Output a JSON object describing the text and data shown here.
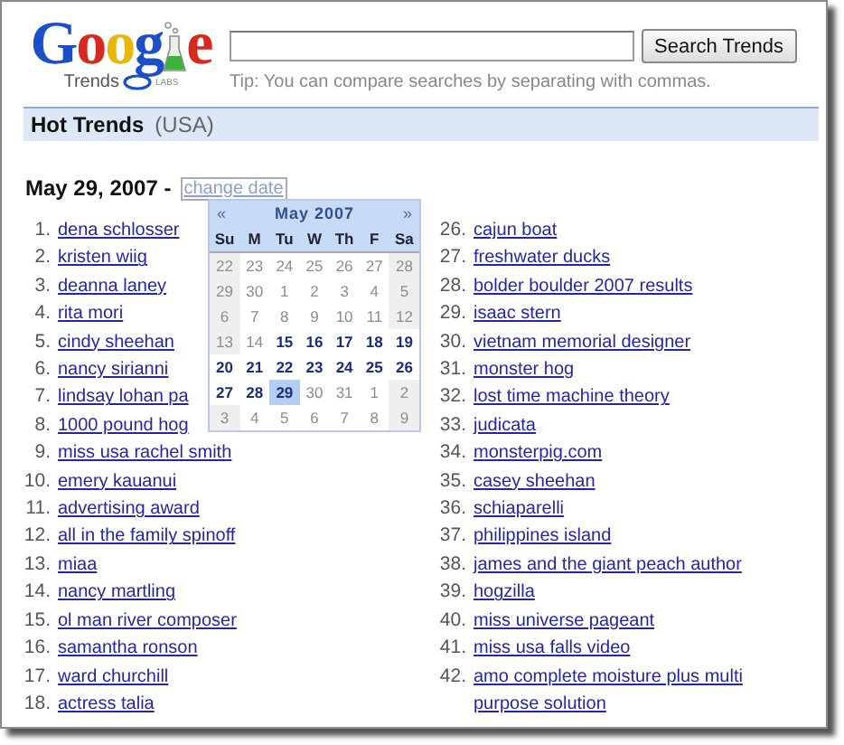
{
  "logo": {
    "text_start": "Goog",
    "text_end": "e",
    "subtitle": "Trends",
    "badge": "LABS"
  },
  "search": {
    "button": "Search Trends",
    "tip": "Tip: You can compare searches by separating with commas."
  },
  "section": {
    "title": "Hot Trends",
    "region": "(USA)"
  },
  "date": {
    "label": "May 29, 2007 -",
    "change_link": "change date"
  },
  "calendar": {
    "prev": "«",
    "month": "May 2007",
    "next": "»",
    "weekdays": [
      "Su",
      "M",
      "Tu",
      "W",
      "Th",
      "F",
      "Sa"
    ],
    "weeks": [
      [
        {
          "day": "22",
          "enabled": false,
          "selected": false
        },
        {
          "day": "23",
          "enabled": false,
          "selected": false
        },
        {
          "day": "24",
          "enabled": false,
          "selected": false
        },
        {
          "day": "25",
          "enabled": false,
          "selected": false
        },
        {
          "day": "26",
          "enabled": false,
          "selected": false
        },
        {
          "day": "27",
          "enabled": false,
          "selected": false
        },
        {
          "day": "28",
          "enabled": false,
          "selected": false
        }
      ],
      [
        {
          "day": "29",
          "enabled": false,
          "selected": false
        },
        {
          "day": "30",
          "enabled": false,
          "selected": false
        },
        {
          "day": "1",
          "enabled": false,
          "selected": false
        },
        {
          "day": "2",
          "enabled": false,
          "selected": false
        },
        {
          "day": "3",
          "enabled": false,
          "selected": false
        },
        {
          "day": "4",
          "enabled": false,
          "selected": false
        },
        {
          "day": "5",
          "enabled": false,
          "selected": false
        }
      ],
      [
        {
          "day": "6",
          "enabled": false,
          "selected": false
        },
        {
          "day": "7",
          "enabled": false,
          "selected": false
        },
        {
          "day": "8",
          "enabled": false,
          "selected": false
        },
        {
          "day": "9",
          "enabled": false,
          "selected": false
        },
        {
          "day": "10",
          "enabled": false,
          "selected": false
        },
        {
          "day": "11",
          "enabled": false,
          "selected": false
        },
        {
          "day": "12",
          "enabled": false,
          "selected": false
        }
      ],
      [
        {
          "day": "13",
          "enabled": false,
          "selected": false
        },
        {
          "day": "14",
          "enabled": false,
          "selected": false
        },
        {
          "day": "15",
          "enabled": true,
          "selected": false
        },
        {
          "day": "16",
          "enabled": true,
          "selected": false
        },
        {
          "day": "17",
          "enabled": true,
          "selected": false
        },
        {
          "day": "18",
          "enabled": true,
          "selected": false
        },
        {
          "day": "19",
          "enabled": true,
          "selected": false
        }
      ],
      [
        {
          "day": "20",
          "enabled": true,
          "selected": false
        },
        {
          "day": "21",
          "enabled": true,
          "selected": false
        },
        {
          "day": "22",
          "enabled": true,
          "selected": false
        },
        {
          "day": "23",
          "enabled": true,
          "selected": false
        },
        {
          "day": "24",
          "enabled": true,
          "selected": false
        },
        {
          "day": "25",
          "enabled": true,
          "selected": false
        },
        {
          "day": "26",
          "enabled": true,
          "selected": false
        }
      ],
      [
        {
          "day": "27",
          "enabled": true,
          "selected": false
        },
        {
          "day": "28",
          "enabled": true,
          "selected": false
        },
        {
          "day": "29",
          "enabled": true,
          "selected": true
        },
        {
          "day": "30",
          "enabled": false,
          "selected": false
        },
        {
          "day": "31",
          "enabled": false,
          "selected": false
        },
        {
          "day": "1",
          "enabled": false,
          "selected": false
        },
        {
          "day": "2",
          "enabled": false,
          "selected": false
        }
      ],
      [
        {
          "day": "3",
          "enabled": false,
          "selected": false
        },
        {
          "day": "4",
          "enabled": false,
          "selected": false
        },
        {
          "day": "5",
          "enabled": false,
          "selected": false
        },
        {
          "day": "6",
          "enabled": false,
          "selected": false
        },
        {
          "day": "7",
          "enabled": false,
          "selected": false
        },
        {
          "day": "8",
          "enabled": false,
          "selected": false
        },
        {
          "day": "9",
          "enabled": false,
          "selected": false
        }
      ]
    ]
  },
  "trends_left": [
    {
      "rank": "1.",
      "term": "dena schlosser"
    },
    {
      "rank": "2.",
      "term": "kristen wiig"
    },
    {
      "rank": "3.",
      "term": "deanna laney"
    },
    {
      "rank": "4.",
      "term": "rita mori"
    },
    {
      "rank": "5.",
      "term": "cindy sheehan"
    },
    {
      "rank": "6.",
      "term": "nancy sirianni"
    },
    {
      "rank": "7.",
      "term": "lindsay lohan pa"
    },
    {
      "rank": "8.",
      "term": "1000 pound hog"
    },
    {
      "rank": "9.",
      "term": "miss usa rachel smith"
    },
    {
      "rank": "10.",
      "term": "emery kauanui"
    },
    {
      "rank": "11.",
      "term": "advertising award"
    },
    {
      "rank": "12.",
      "term": "all in the family spinoff"
    },
    {
      "rank": "13.",
      "term": "miaa"
    },
    {
      "rank": "14.",
      "term": "nancy martling"
    },
    {
      "rank": "15.",
      "term": "ol man river composer"
    },
    {
      "rank": "16.",
      "term": "samantha ronson"
    },
    {
      "rank": "17.",
      "term": "ward churchill"
    },
    {
      "rank": "18.",
      "term": "actress talia"
    }
  ],
  "trends_right": [
    {
      "rank": "26.",
      "term": "cajun boat"
    },
    {
      "rank": "27.",
      "term": "freshwater ducks"
    },
    {
      "rank": "28.",
      "term": "bolder boulder 2007 results"
    },
    {
      "rank": "29.",
      "term": "isaac stern"
    },
    {
      "rank": "30.",
      "term": "vietnam memorial designer"
    },
    {
      "rank": "31.",
      "term": "monster hog"
    },
    {
      "rank": "32.",
      "term": "lost time machine theory"
    },
    {
      "rank": "33.",
      "term": "judicata"
    },
    {
      "rank": "34.",
      "term": "monsterpig.com"
    },
    {
      "rank": "35.",
      "term": "casey sheehan"
    },
    {
      "rank": "36.",
      "term": "schiaparelli"
    },
    {
      "rank": "37.",
      "term": "philippines island"
    },
    {
      "rank": "38.",
      "term": "james and the giant peach author"
    },
    {
      "rank": "39.",
      "term": "hogzilla"
    },
    {
      "rank": "40.",
      "term": "miss universe pageant"
    },
    {
      "rank": "41.",
      "term": "miss usa falls video"
    },
    {
      "rank": "42.",
      "term": "amo complete moisture plus multi purpose solution"
    }
  ]
}
